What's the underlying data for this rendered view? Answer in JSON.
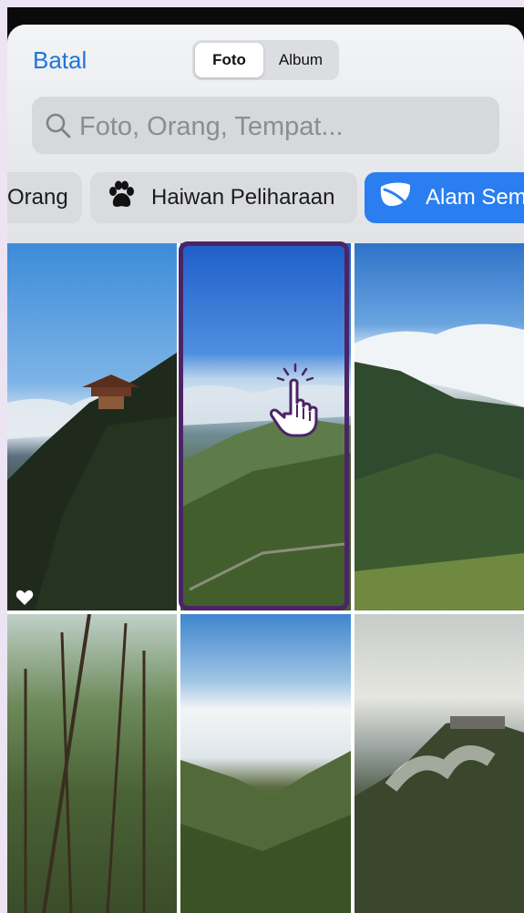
{
  "header": {
    "cancel_label": "Batal",
    "segments": [
      {
        "label": "Foto",
        "selected": true
      },
      {
        "label": "Album",
        "selected": false
      }
    ]
  },
  "search": {
    "placeholder": "Foto, Orang, Tempat...",
    "icon": "search-icon"
  },
  "chips": [
    {
      "label": "Orang",
      "icon": null,
      "selected": false
    },
    {
      "label": "Haiwan Peliharaan",
      "icon": "paw-icon",
      "selected": false
    },
    {
      "label": "Alam Sem",
      "icon": "leaf-icon",
      "selected": true
    }
  ],
  "colors": {
    "accent": "#1f74d8",
    "chip_selected": "#2b7ef0",
    "selection_border": "#4b2465"
  },
  "photos": [
    {
      "subject": "pagoda on mountain peak above clouds",
      "favorite": true
    },
    {
      "subject": "green valley with terraced slopes",
      "selected": true
    },
    {
      "subject": "mountain ridge with clouds"
    },
    {
      "subject": "tall pine forest looking up"
    },
    {
      "subject": "valley above sea of clouds"
    },
    {
      "subject": "misty sunlit hillside"
    }
  ]
}
